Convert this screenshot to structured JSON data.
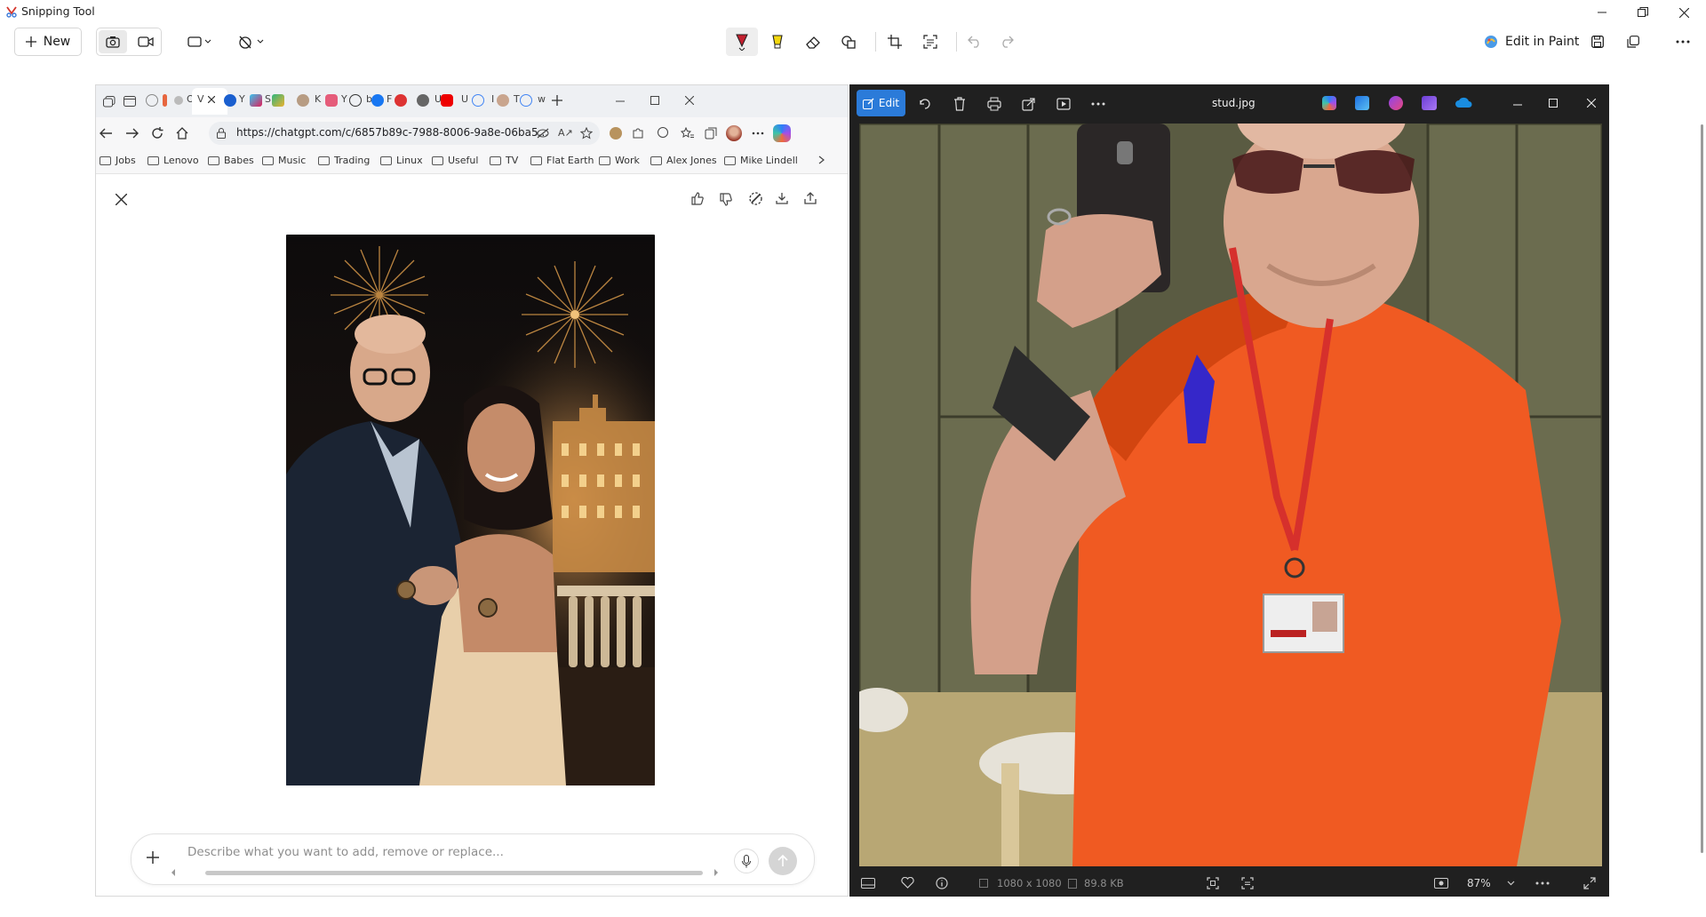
{
  "snipping": {
    "app_title": "Snipping Tool",
    "new_label": "New",
    "edit_in_paint_label": "Edit in Paint"
  },
  "browser": {
    "url": "https://chatgpt.com/c/6857b89c-7988-8006-9a8e-06ba5...",
    "tab_letters": [
      "O",
      "V",
      "Y",
      "S",
      "K",
      "Y",
      "b",
      "F",
      "U",
      "U",
      "I",
      "T",
      "w"
    ],
    "bookmarks": [
      "Jobs",
      "Lenovo",
      "Babes",
      "Music",
      "Trading",
      "Linux",
      "Useful",
      "TV",
      "Flat Earth",
      "Work",
      "Alex Jones",
      "Mike Lindell"
    ],
    "prompt_placeholder": "Describe what you want to add, remove or replace..."
  },
  "photos": {
    "edit_label": "Edit",
    "file_name": "stud.jpg",
    "dimensions": "1080 x 1080",
    "file_size": "89.8 KB",
    "zoom": "87%"
  },
  "colors": {
    "accent_blue": "#2b7bd9",
    "pen_red": "#c3202f",
    "highlighter_yellow": "#f2d70f",
    "shirt_orange": "#f05a22"
  }
}
